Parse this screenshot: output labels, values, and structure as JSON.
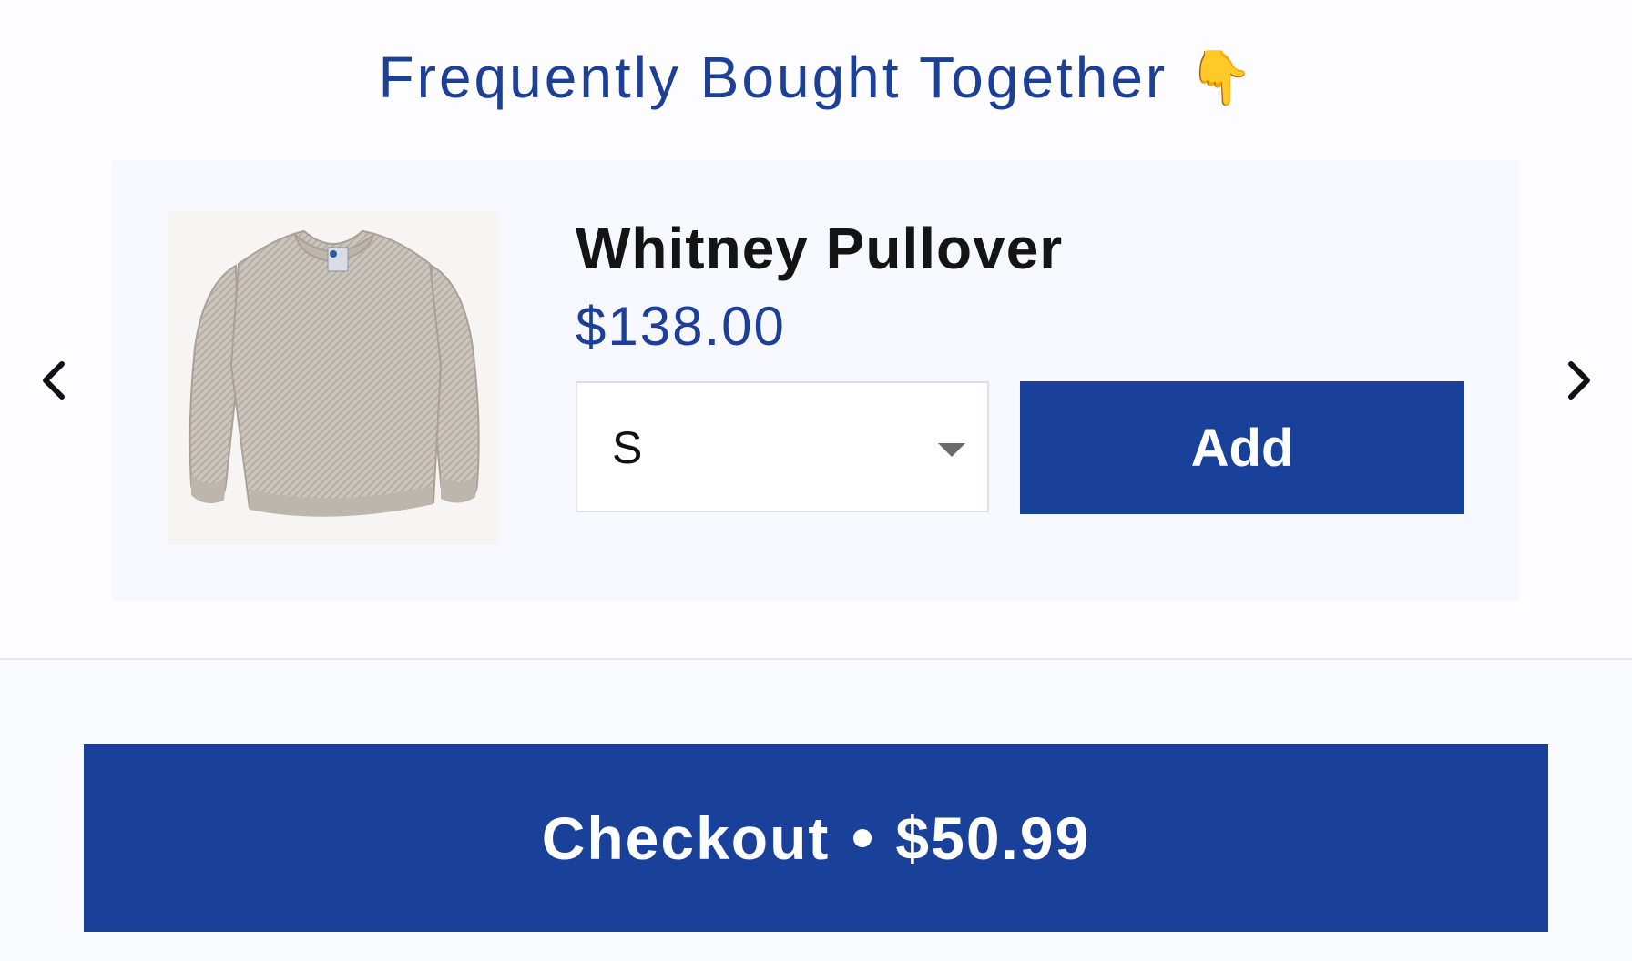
{
  "section": {
    "title": "Frequently Bought Together",
    "emoji": "👇"
  },
  "carousel": {
    "prev_icon": "chevron-left-icon",
    "next_icon": "chevron-right-icon"
  },
  "product": {
    "name": "Whitney Pullover",
    "price": "$138.00",
    "image": "sweater-icon",
    "size_select": {
      "selected": "S"
    },
    "add_label": "Add"
  },
  "checkout": {
    "label": "Checkout",
    "total": "$50.99"
  },
  "colors": {
    "brand_blue": "#1a419a",
    "title_blue": "#1c3f97",
    "card_bg": "#f6f8fd"
  }
}
